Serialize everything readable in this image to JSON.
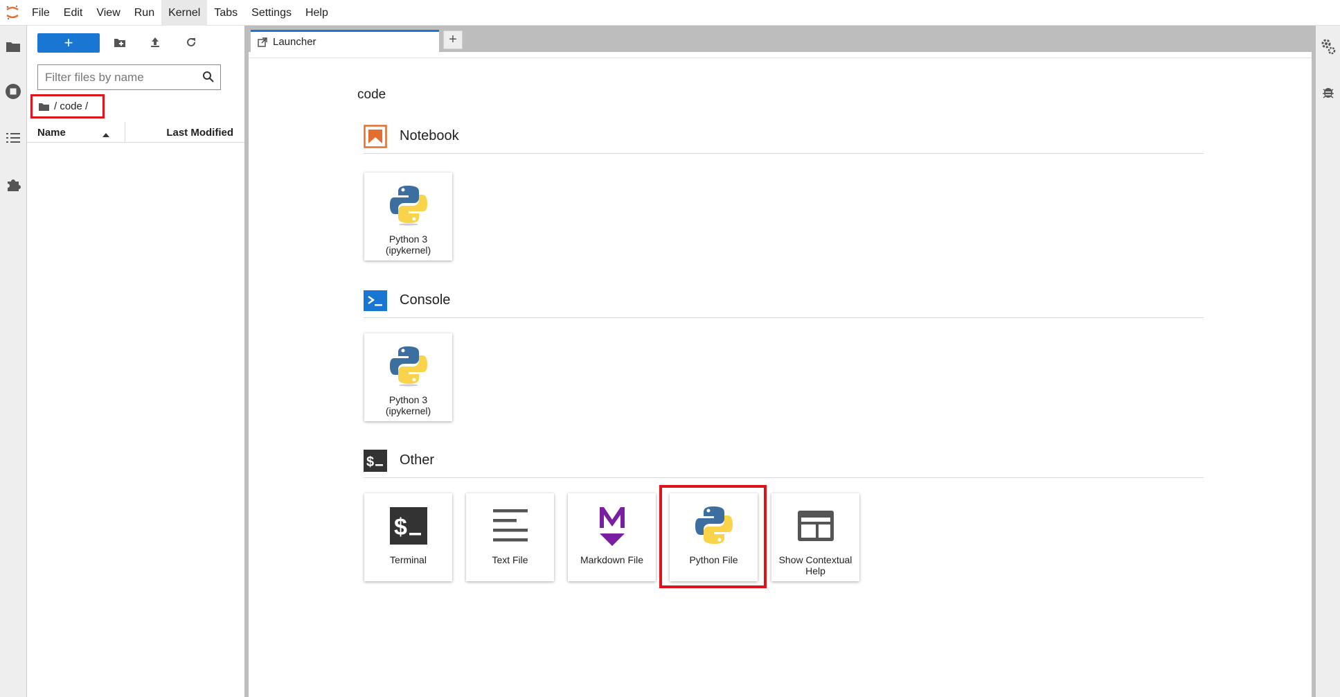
{
  "menubar": {
    "items": [
      "File",
      "Edit",
      "View",
      "Run",
      "Kernel",
      "Tabs",
      "Settings",
      "Help"
    ],
    "active_item": "Kernel"
  },
  "left_strip": {
    "icons": [
      "folder-icon",
      "running-icon",
      "toc-icon",
      "extension-icon"
    ]
  },
  "filebrowser": {
    "new_label": "+",
    "filter_placeholder": "Filter files by name",
    "breadcrumb_path": "/ code /",
    "columns": {
      "name": "Name",
      "modified": "Last Modified"
    }
  },
  "tabs": [
    {
      "label": "Launcher"
    }
  ],
  "add_tab_label": "+",
  "launcher": {
    "title": "code",
    "sections": [
      {
        "title": "Notebook",
        "cards": [
          {
            "label": "Python 3 (ipykernel)"
          }
        ]
      },
      {
        "title": "Console",
        "cards": [
          {
            "label": "Python 3 (ipykernel)"
          }
        ]
      },
      {
        "title": "Other",
        "cards": [
          {
            "label": "Terminal"
          },
          {
            "label": "Text File"
          },
          {
            "label": "Markdown File"
          },
          {
            "label": "Python File"
          },
          {
            "label": "Show Contextual Help"
          }
        ]
      }
    ]
  },
  "colors": {
    "accent": "#1976d2",
    "highlight": "#e0121c",
    "notebook": "#e46e2e",
    "console": "#1976d2",
    "markdown": "#7b1fa2",
    "python_blue": "#3c6e9f",
    "python_yellow": "#f9d44a"
  }
}
